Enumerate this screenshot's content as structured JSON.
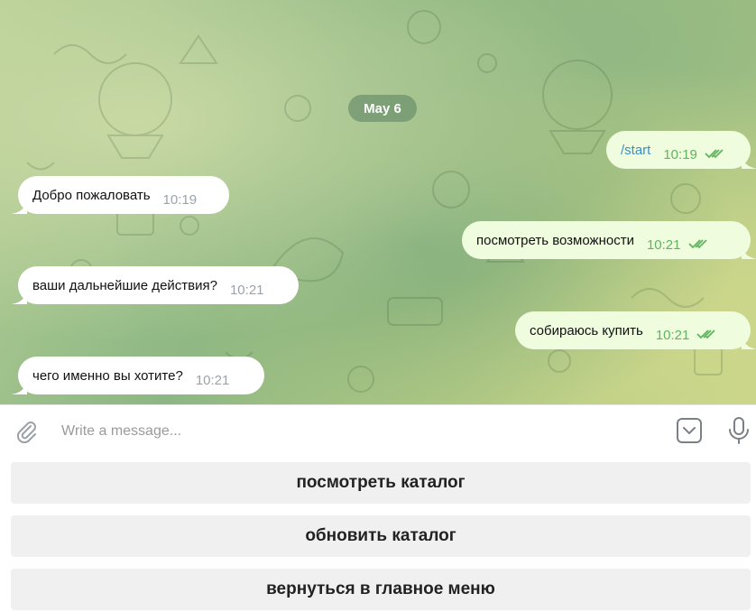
{
  "chat": {
    "date_label": "May 6",
    "messages": [
      {
        "direction": "out",
        "text": "/start",
        "time": "10:19"
      },
      {
        "direction": "in",
        "text": "Добро пожаловать",
        "time": "10:19"
      },
      {
        "direction": "out",
        "text": "посмотреть возможности",
        "time": "10:21"
      },
      {
        "direction": "in",
        "text": "ваши дальнейшие действия?",
        "time": "10:21"
      },
      {
        "direction": "out",
        "text": "собираюсь купить",
        "time": "10:21"
      },
      {
        "direction": "in",
        "text": "чего именно вы хотите?",
        "time": "10:21"
      }
    ]
  },
  "composer": {
    "placeholder": "Write a message...",
    "value": ""
  },
  "keyboard": {
    "buttons": [
      {
        "label": "посмотреть каталог"
      },
      {
        "label": "обновить каталог"
      },
      {
        "label": "вернуться в главное меню"
      }
    ]
  },
  "colors": {
    "incoming_bubble": "#ffffff",
    "outgoing_bubble": "#effdde",
    "outgoing_time": "#5fb45d",
    "command_link": "#3a8ec7",
    "keyboard_button": "#f0f0f0"
  },
  "icons": {
    "attach": "paperclip-icon",
    "keyboard": "bot-keyboard-icon",
    "mic": "microphone-icon",
    "read": "double-check-icon"
  }
}
